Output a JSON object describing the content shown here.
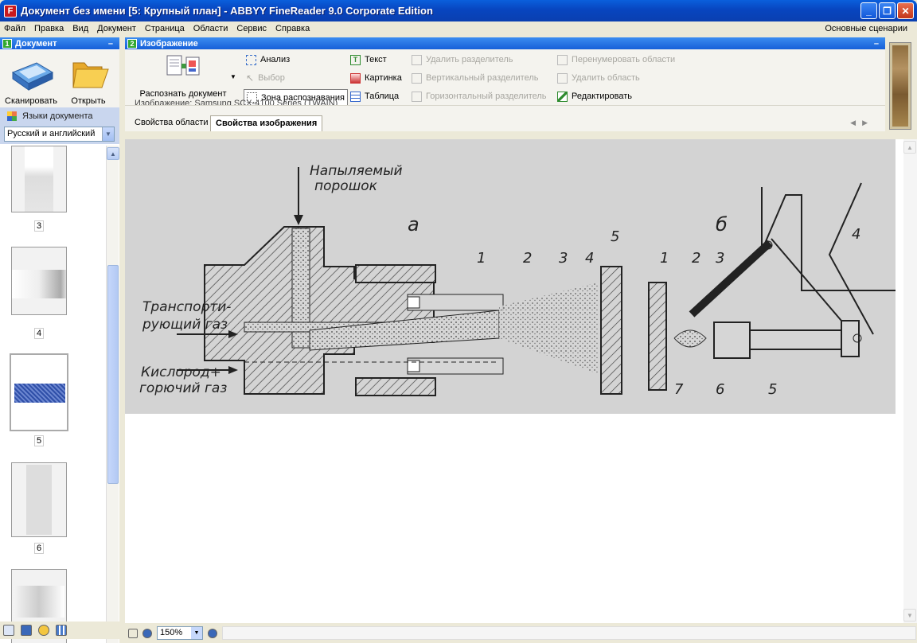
{
  "window": {
    "title": "Документ без имени [5: Крупный план] - ABBYY FineReader 9.0 Corporate Edition"
  },
  "menu": {
    "items": [
      "Файл",
      "Правка",
      "Вид",
      "Документ",
      "Страница",
      "Области",
      "Сервис",
      "Справка"
    ],
    "scenarios": "Основные сценарии"
  },
  "document_panel": {
    "number": "1",
    "title": "Документ",
    "scan_label": "Сканировать",
    "open_label": "Открыть",
    "languages_label": "Языки документа",
    "language_value": "Русский и английский"
  },
  "thumbnails": [
    {
      "num": "3"
    },
    {
      "num": "4"
    },
    {
      "num": "5",
      "selected": true
    },
    {
      "num": "6"
    }
  ],
  "image_panel": {
    "number": "2",
    "title": "Изображение",
    "recognize_label": "Распознать документ",
    "tools": {
      "analyze": "Анализ",
      "select": "Выбор",
      "zone": "Зона распознавания",
      "text": "Текст",
      "picture": "Картинка",
      "table": "Таблица",
      "del_separator": "Удалить разделитель",
      "vert_separator": "Вертикальный разделитель",
      "horiz_separator": "Горизонтальный разделитель",
      "renumber": "Перенумеровать области",
      "del_area": "Удалить область",
      "edit": "Редактировать"
    },
    "partial_line": "Изображение:     Samsung SCX-4100 Series (TWAIN)",
    "tabs": [
      "Свойства области",
      "Свойства изображения"
    ]
  },
  "zoom": {
    "value": "150%"
  },
  "drawing": {
    "powder": "Напыляемый",
    "powder2": "порошок",
    "label_a": "а",
    "label_b": "б",
    "transport1": "Транспорти-",
    "transport2": "рующий газ",
    "oxygen1": "Кислород+",
    "oxygen2": "горючий газ",
    "nums": [
      "1",
      "2",
      "3",
      "4",
      "5",
      "1",
      "2",
      "3",
      "4",
      "7",
      "6",
      "5"
    ]
  }
}
